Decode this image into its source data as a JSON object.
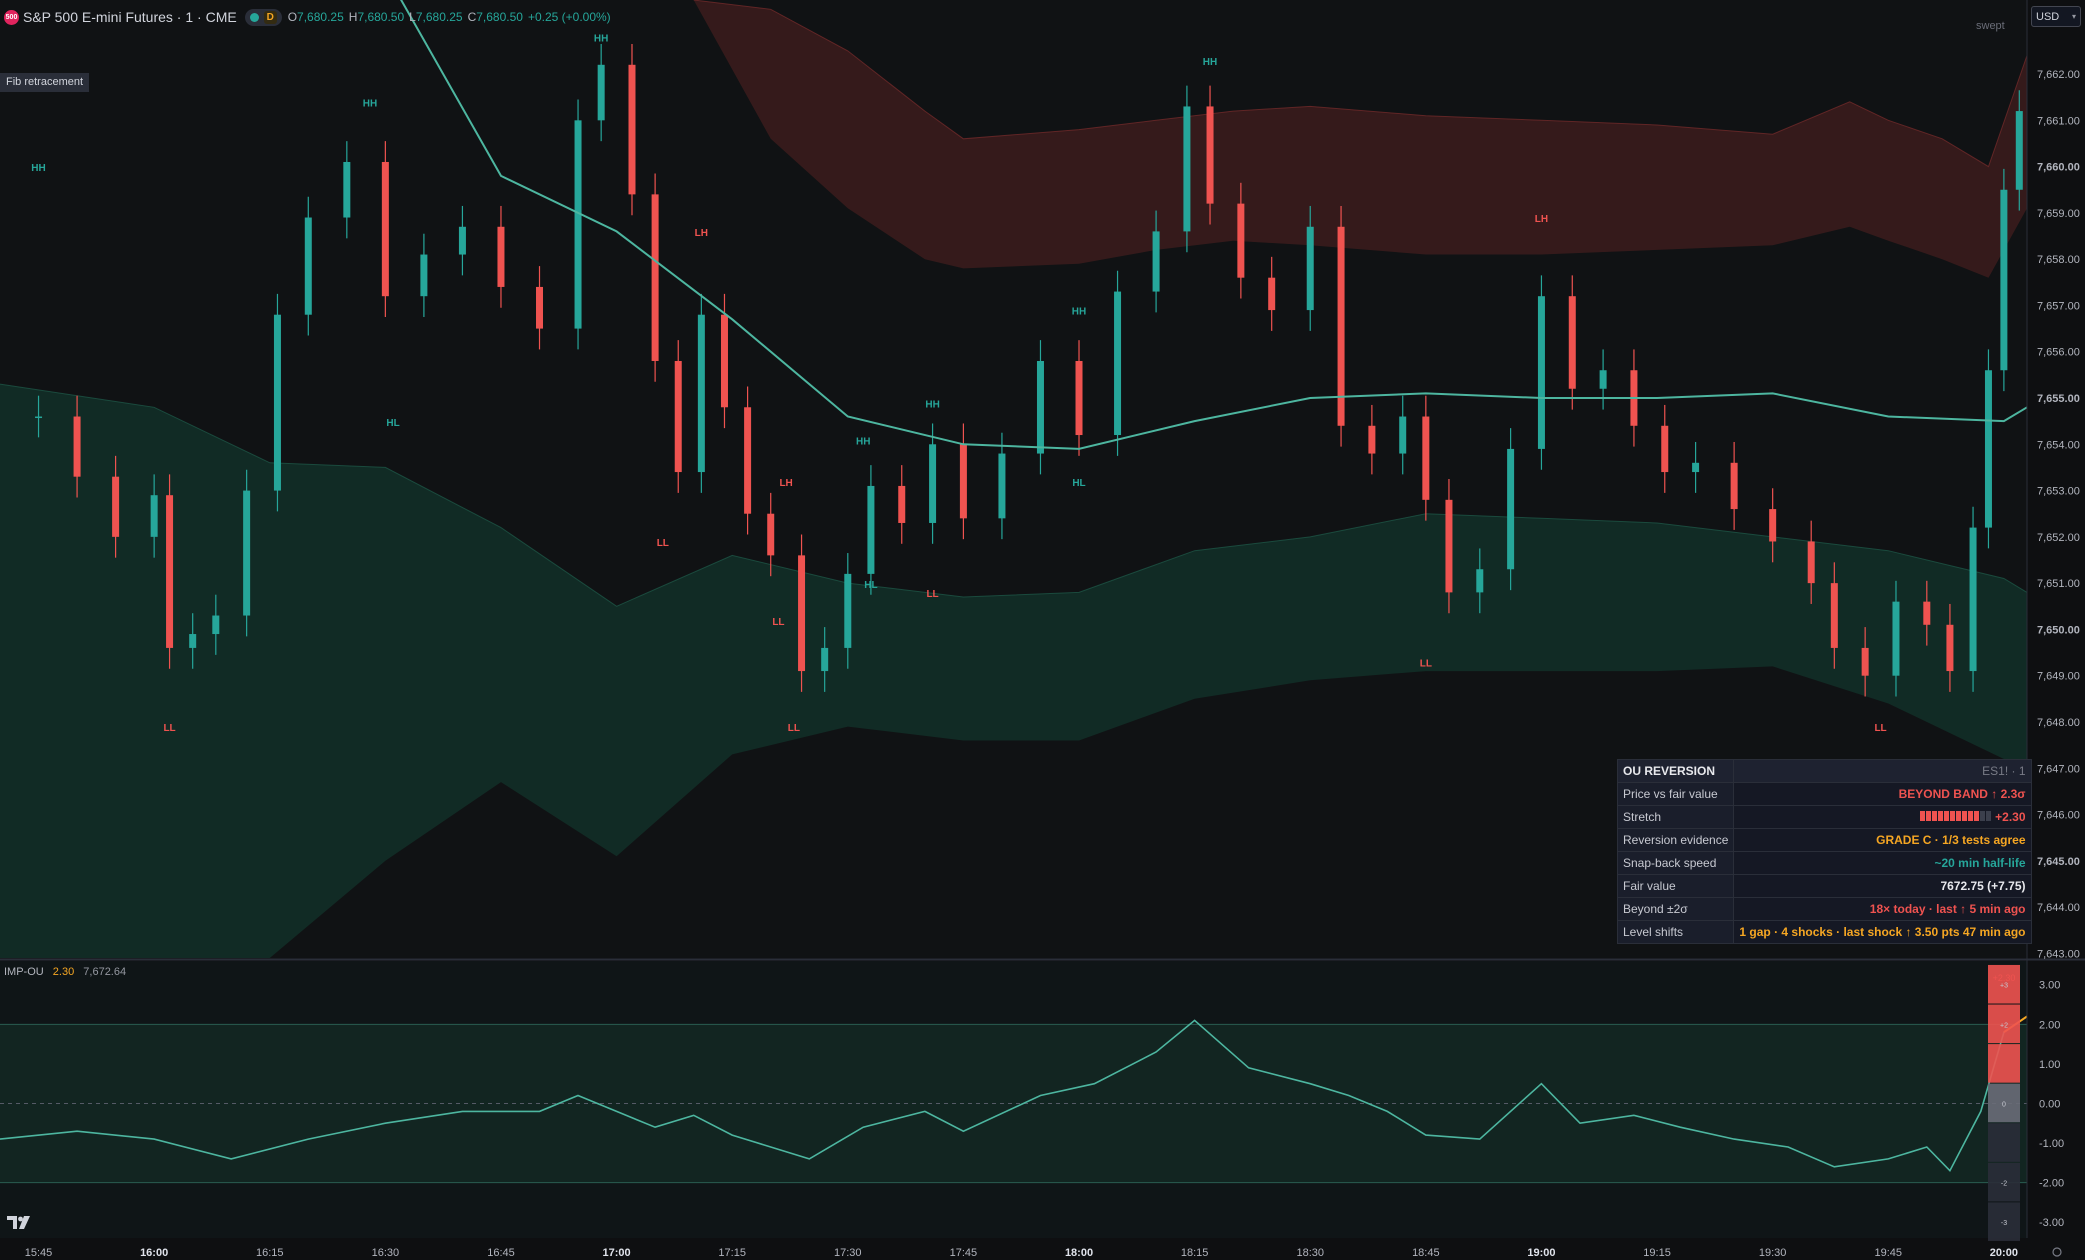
{
  "header": {
    "symbol_badge": "500",
    "title": "S&P 500 E-mini Futures · 1 · CME",
    "pill_letter": "D",
    "ohlc": [
      {
        "label": "O",
        "value": "7,680.25"
      },
      {
        "label": "H",
        "value": "7,680.50"
      },
      {
        "label": "L",
        "value": "7,680.25"
      },
      {
        "label": "C",
        "value": "7,680.50"
      }
    ],
    "change": "+0.25 (+0.00%)"
  },
  "tooltip": "Fib retracement",
  "currency": "USD",
  "swept_label": "swept",
  "indicator": {
    "name": "IMP-OU",
    "value1": "2.30",
    "value2": "7,672.64"
  },
  "colors": {
    "up": "#26a69a",
    "down": "#ef5350",
    "band_upper": "#3a1c1c",
    "band_lower": "#123028",
    "fair_value": "#4db6a0",
    "moving_average": "#b8bcc4",
    "oscillator": "#4db6a0",
    "alert": "#f5a623",
    "panel_bg": "#151824"
  },
  "price_axis": {
    "labels": [
      "7,662.00",
      "7,661.00",
      "7,660.00",
      "7,659.00",
      "7,658.00",
      "7,657.00",
      "7,656.00",
      "7,655.00",
      "7,654.00",
      "7,653.00",
      "7,652.00",
      "7,651.00",
      "7,650.00",
      "7,649.00",
      "7,648.00",
      "7,647.00",
      "7,646.00",
      "7,645.00",
      "7,644.00",
      "7,643.00"
    ],
    "bold": [
      "7,660.00",
      "7,655.00",
      "7,650.00",
      "7,645.00"
    ]
  },
  "osc_axis": {
    "labels": [
      "3.00",
      "2.00",
      "1.00",
      "0.00",
      "-1.00",
      "-2.00",
      "-3.00"
    ],
    "current_value": "+2.30"
  },
  "osc_ladder": [
    {
      "label": "+3",
      "level": 3
    },
    {
      "label": "+2",
      "level": 2
    },
    {
      "label": "",
      "level": 1
    },
    {
      "label": "0",
      "level": 0
    },
    {
      "label": "",
      "level": -1
    },
    {
      "label": "-2",
      "level": -2
    },
    {
      "label": "-3",
      "level": -3
    }
  ],
  "time_axis": [
    {
      "label": "15:45",
      "bold": false
    },
    {
      "label": "16:00",
      "bold": true
    },
    {
      "label": "16:15",
      "bold": false
    },
    {
      "label": "16:30",
      "bold": false
    },
    {
      "label": "16:45",
      "bold": false
    },
    {
      "label": "17:00",
      "bold": true
    },
    {
      "label": "17:15",
      "bold": false
    },
    {
      "label": "17:30",
      "bold": false
    },
    {
      "label": "17:45",
      "bold": false
    },
    {
      "label": "18:00",
      "bold": true
    },
    {
      "label": "18:15",
      "bold": false
    },
    {
      "label": "18:30",
      "bold": false
    },
    {
      "label": "18:45",
      "bold": false
    },
    {
      "label": "19:00",
      "bold": true
    },
    {
      "label": "19:15",
      "bold": false
    },
    {
      "label": "19:30",
      "bold": false
    },
    {
      "label": "19:45",
      "bold": false
    },
    {
      "label": "20:00",
      "bold": true
    }
  ],
  "swing_labels": [
    {
      "text": "HH",
      "time": "15:45",
      "price": 7659.9
    },
    {
      "text": "HH",
      "time": "16:28",
      "price": 7661.3
    },
    {
      "text": "HL",
      "time": "16:31",
      "price": 7654.4
    },
    {
      "text": "LL",
      "time": "16:02",
      "price": 7647.8
    },
    {
      "text": "HH",
      "time": "16:58",
      "price": 7662.7
    },
    {
      "text": "LH",
      "time": "17:11",
      "price": 7658.5
    },
    {
      "text": "LL",
      "time": "17:06",
      "price": 7651.8
    },
    {
      "text": "LH",
      "time": "17:22",
      "price": 7653.1
    },
    {
      "text": "LL",
      "time": "17:21",
      "price": 7650.1
    },
    {
      "text": "LL",
      "time": "17:23",
      "price": 7647.8
    },
    {
      "text": "HH",
      "time": "17:32",
      "price": 7654.0
    },
    {
      "text": "HL",
      "time": "17:33",
      "price": 7650.9
    },
    {
      "text": "HH",
      "time": "17:41",
      "price": 7654.8
    },
    {
      "text": "LL",
      "time": "17:41",
      "price": 7650.7
    },
    {
      "text": "HH",
      "time": "18:00",
      "price": 7656.8
    },
    {
      "text": "HL",
      "time": "18:00",
      "price": 7653.1
    },
    {
      "text": "HH",
      "time": "18:17",
      "price": 7662.2
    },
    {
      "text": "LH",
      "time": "19:00",
      "price": 7658.8
    },
    {
      "text": "LL",
      "time": "18:45",
      "price": 7649.2
    },
    {
      "text": "LL",
      "time": "19:44",
      "price": 7647.8
    }
  ],
  "chart_data": {
    "type": "candlestick",
    "x_range": [
      "15:40",
      "20:03"
    ],
    "ylim": [
      7642.9,
      7663.6
    ],
    "price_series": [
      {
        "time": "15:45",
        "price": 7654.6
      },
      {
        "time": "15:50",
        "price": 7653.3
      },
      {
        "time": "15:55",
        "price": 7652.0
      },
      {
        "time": "16:00",
        "price": 7652.9
      },
      {
        "time": "16:02",
        "price": 7649.6
      },
      {
        "time": "16:05",
        "price": 7649.9
      },
      {
        "time": "16:08",
        "price": 7650.3
      },
      {
        "time": "16:12",
        "price": 7653.0
      },
      {
        "time": "16:16",
        "price": 7656.8
      },
      {
        "time": "16:20",
        "price": 7658.9
      },
      {
        "time": "16:25",
        "price": 7660.1
      },
      {
        "time": "16:30",
        "price": 7657.2
      },
      {
        "time": "16:35",
        "price": 7658.1
      },
      {
        "time": "16:40",
        "price": 7658.7
      },
      {
        "time": "16:45",
        "price": 7657.4
      },
      {
        "time": "16:50",
        "price": 7656.5
      },
      {
        "time": "16:55",
        "price": 7661.0
      },
      {
        "time": "16:58",
        "price": 7662.2
      },
      {
        "time": "17:02",
        "price": 7659.4
      },
      {
        "time": "17:05",
        "price": 7655.8
      },
      {
        "time": "17:08",
        "price": 7653.4
      },
      {
        "time": "17:11",
        "price": 7656.8
      },
      {
        "time": "17:14",
        "price": 7654.8
      },
      {
        "time": "17:17",
        "price": 7652.5
      },
      {
        "time": "17:20",
        "price": 7651.6
      },
      {
        "time": "17:24",
        "price": 7649.1
      },
      {
        "time": "17:27",
        "price": 7649.6
      },
      {
        "time": "17:30",
        "price": 7651.2
      },
      {
        "time": "17:33",
        "price": 7653.1
      },
      {
        "time": "17:37",
        "price": 7652.3
      },
      {
        "time": "17:41",
        "price": 7654.0
      },
      {
        "time": "17:45",
        "price": 7652.4
      },
      {
        "time": "17:50",
        "price": 7653.8
      },
      {
        "time": "17:55",
        "price": 7655.8
      },
      {
        "time": "18:00",
        "price": 7654.2
      },
      {
        "time": "18:05",
        "price": 7657.3
      },
      {
        "time": "18:10",
        "price": 7658.6
      },
      {
        "time": "18:14",
        "price": 7661.3
      },
      {
        "time": "18:17",
        "price": 7659.2
      },
      {
        "time": "18:21",
        "price": 7657.6
      },
      {
        "time": "18:25",
        "price": 7656.9
      },
      {
        "time": "18:30",
        "price": 7658.7
      },
      {
        "time": "18:34",
        "price": 7654.4
      },
      {
        "time": "18:38",
        "price": 7653.8
      },
      {
        "time": "18:42",
        "price": 7654.6
      },
      {
        "time": "18:45",
        "price": 7652.8
      },
      {
        "time": "18:48",
        "price": 7650.8
      },
      {
        "time": "18:52",
        "price": 7651.3
      },
      {
        "time": "18:56",
        "price": 7653.9
      },
      {
        "time": "19:00",
        "price": 7657.2
      },
      {
        "time": "19:04",
        "price": 7655.2
      },
      {
        "time": "19:08",
        "price": 7655.6
      },
      {
        "time": "19:12",
        "price": 7654.4
      },
      {
        "time": "19:16",
        "price": 7653.4
      },
      {
        "time": "19:20",
        "price": 7653.6
      },
      {
        "time": "19:25",
        "price": 7652.6
      },
      {
        "time": "19:30",
        "price": 7651.9
      },
      {
        "time": "19:35",
        "price": 7651.0
      },
      {
        "time": "19:38",
        "price": 7649.6
      },
      {
        "time": "19:42",
        "price": 7649.0
      },
      {
        "time": "19:46",
        "price": 7650.6
      },
      {
        "time": "19:50",
        "price": 7650.1
      },
      {
        "time": "19:53",
        "price": 7649.1
      },
      {
        "time": "19:56",
        "price": 7652.2
      },
      {
        "time": "19:58",
        "price": 7655.6
      },
      {
        "time": "20:00",
        "price": 7659.5
      },
      {
        "time": "20:02",
        "price": 7661.2
      }
    ],
    "fair_value": [
      {
        "time": "16:30",
        "price": 7664.2
      },
      {
        "time": "16:45",
        "price": 7659.8
      },
      {
        "time": "17:00",
        "price": 7658.6
      },
      {
        "time": "17:15",
        "price": 7656.7
      },
      {
        "time": "17:30",
        "price": 7654.6
      },
      {
        "time": "17:45",
        "price": 7654.0
      },
      {
        "time": "18:00",
        "price": 7653.9
      },
      {
        "time": "18:15",
        "price": 7654.5
      },
      {
        "time": "18:30",
        "price": 7655.0
      },
      {
        "time": "18:45",
        "price": 7655.1
      },
      {
        "time": "19:00",
        "price": 7655.0
      },
      {
        "time": "19:15",
        "price": 7655.0
      },
      {
        "time": "19:30",
        "price": 7655.1
      },
      {
        "time": "19:45",
        "price": 7654.6
      },
      {
        "time": "20:00",
        "price": 7654.5
      },
      {
        "time": "20:03",
        "price": 7654.8
      }
    ],
    "upper_band": [
      {
        "time": "17:10",
        "upper": 7663.6,
        "lower": 7663.6
      },
      {
        "time": "17:20",
        "upper": 7663.4,
        "lower": 7660.6
      },
      {
        "time": "17:30",
        "upper": 7662.5,
        "lower": 7659.1
      },
      {
        "time": "17:40",
        "upper": 7661.2,
        "lower": 7658.0
      },
      {
        "time": "17:45",
        "upper": 7660.6,
        "lower": 7657.8
      },
      {
        "time": "18:00",
        "upper": 7660.8,
        "lower": 7657.9
      },
      {
        "time": "18:10",
        "upper": 7661.0,
        "lower": 7658.2
      },
      {
        "time": "18:20",
        "upper": 7661.2,
        "lower": 7658.4
      },
      {
        "time": "18:30",
        "upper": 7661.3,
        "lower": 7658.3
      },
      {
        "time": "18:45",
        "upper": 7661.1,
        "lower": 7658.1
      },
      {
        "time": "19:00",
        "upper": 7661.0,
        "lower": 7658.1
      },
      {
        "time": "19:15",
        "upper": 7660.9,
        "lower": 7658.2
      },
      {
        "time": "19:30",
        "upper": 7660.7,
        "lower": 7658.3
      },
      {
        "time": "19:40",
        "upper": 7661.4,
        "lower": 7658.7
      },
      {
        "time": "19:45",
        "upper": 7661.0,
        "lower": 7658.4
      },
      {
        "time": "19:52",
        "upper": 7660.6,
        "lower": 7658.0
      },
      {
        "time": "19:58",
        "upper": 7660.0,
        "lower": 7657.6
      },
      {
        "time": "20:03",
        "upper": 7662.4,
        "lower": 7659.1
      }
    ],
    "lower_band": [
      {
        "time": "15:40",
        "upper": 7655.3,
        "lower": 7642.9
      },
      {
        "time": "16:00",
        "upper": 7654.8,
        "lower": 7642.9
      },
      {
        "time": "16:15",
        "upper": 7653.6,
        "lower": 7642.9
      },
      {
        "time": "16:30",
        "upper": 7653.5,
        "lower": 7645.0
      },
      {
        "time": "16:45",
        "upper": 7652.2,
        "lower": 7646.7
      },
      {
        "time": "17:00",
        "upper": 7650.5,
        "lower": 7645.1
      },
      {
        "time": "17:15",
        "upper": 7651.6,
        "lower": 7647.3
      },
      {
        "time": "17:30",
        "upper": 7651.0,
        "lower": 7647.9
      },
      {
        "time": "17:45",
        "upper": 7650.7,
        "lower": 7647.6
      },
      {
        "time": "18:00",
        "upper": 7650.8,
        "lower": 7647.6
      },
      {
        "time": "18:15",
        "upper": 7651.7,
        "lower": 7648.5
      },
      {
        "time": "18:30",
        "upper": 7652.0,
        "lower": 7648.9
      },
      {
        "time": "18:45",
        "upper": 7652.5,
        "lower": 7649.1
      },
      {
        "time": "19:00",
        "upper": 7652.4,
        "lower": 7649.1
      },
      {
        "time": "19:15",
        "upper": 7652.3,
        "lower": 7649.1
      },
      {
        "time": "19:30",
        "upper": 7652.0,
        "lower": 7649.2
      },
      {
        "time": "19:45",
        "upper": 7651.7,
        "lower": 7648.4
      },
      {
        "time": "20:00",
        "upper": 7651.1,
        "lower": 7647.2
      },
      {
        "time": "20:03",
        "upper": 7650.8,
        "lower": 7646.8
      }
    ],
    "oscillator": [
      {
        "time": "15:40",
        "value": -0.9
      },
      {
        "time": "15:50",
        "value": -0.7
      },
      {
        "time": "16:00",
        "value": -0.9
      },
      {
        "time": "16:10",
        "value": -1.4
      },
      {
        "time": "16:20",
        "value": -0.9
      },
      {
        "time": "16:30",
        "value": -0.5
      },
      {
        "time": "16:40",
        "value": -0.2
      },
      {
        "time": "16:50",
        "value": -0.2
      },
      {
        "time": "16:55",
        "value": 0.2
      },
      {
        "time": "17:00",
        "value": -0.2
      },
      {
        "time": "17:05",
        "value": -0.6
      },
      {
        "time": "17:10",
        "value": -0.3
      },
      {
        "time": "17:15",
        "value": -0.8
      },
      {
        "time": "17:25",
        "value": -1.4
      },
      {
        "time": "17:32",
        "value": -0.6
      },
      {
        "time": "17:40",
        "value": -0.2
      },
      {
        "time": "17:45",
        "value": -0.7
      },
      {
        "time": "17:55",
        "value": 0.2
      },
      {
        "time": "18:02",
        "value": 0.5
      },
      {
        "time": "18:10",
        "value": 1.3
      },
      {
        "time": "18:15",
        "value": 2.1
      },
      {
        "time": "18:22",
        "value": 0.9
      },
      {
        "time": "18:30",
        "value": 0.5
      },
      {
        "time": "18:35",
        "value": 0.2
      },
      {
        "time": "18:40",
        "value": -0.2
      },
      {
        "time": "18:45",
        "value": -0.8
      },
      {
        "time": "18:52",
        "value": -0.9
      },
      {
        "time": "19:00",
        "value": 0.5
      },
      {
        "time": "19:05",
        "value": -0.5
      },
      {
        "time": "19:12",
        "value": -0.3
      },
      {
        "time": "19:18",
        "value": -0.6
      },
      {
        "time": "19:25",
        "value": -0.9
      },
      {
        "time": "19:32",
        "value": -1.1
      },
      {
        "time": "19:38",
        "value": -1.6
      },
      {
        "time": "19:45",
        "value": -1.4
      },
      {
        "time": "19:50",
        "value": -1.1
      },
      {
        "time": "19:53",
        "value": -1.7
      },
      {
        "time": "19:57",
        "value": -0.2
      },
      {
        "time": "20:00",
        "value": 1.8
      },
      {
        "time": "20:03",
        "value": 2.2
      }
    ]
  },
  "ou_panel": {
    "title": "OU REVERSION",
    "context": "ES1! · 1",
    "rows": [
      {
        "label": "Price vs fair value",
        "value": "BEYOND BAND ↑ 2.3σ"
      },
      {
        "label": "Stretch",
        "value": "+2.30"
      },
      {
        "label": "Reversion evidence",
        "value": "GRADE C · 1/3 tests agree"
      },
      {
        "label": "Snap-back speed",
        "value": "~20 min half-life"
      },
      {
        "label": "Fair value",
        "value": "7672.75 (+7.75)"
      },
      {
        "label": "Beyond ±2σ",
        "value": "18× today · last ↑ 5 min ago"
      },
      {
        "label": "Level shifts",
        "value": "1 gap · 4 shocks · last shock ↑ 3.50 pts 47 min ago"
      }
    ],
    "stretch_fill": 0.8
  }
}
